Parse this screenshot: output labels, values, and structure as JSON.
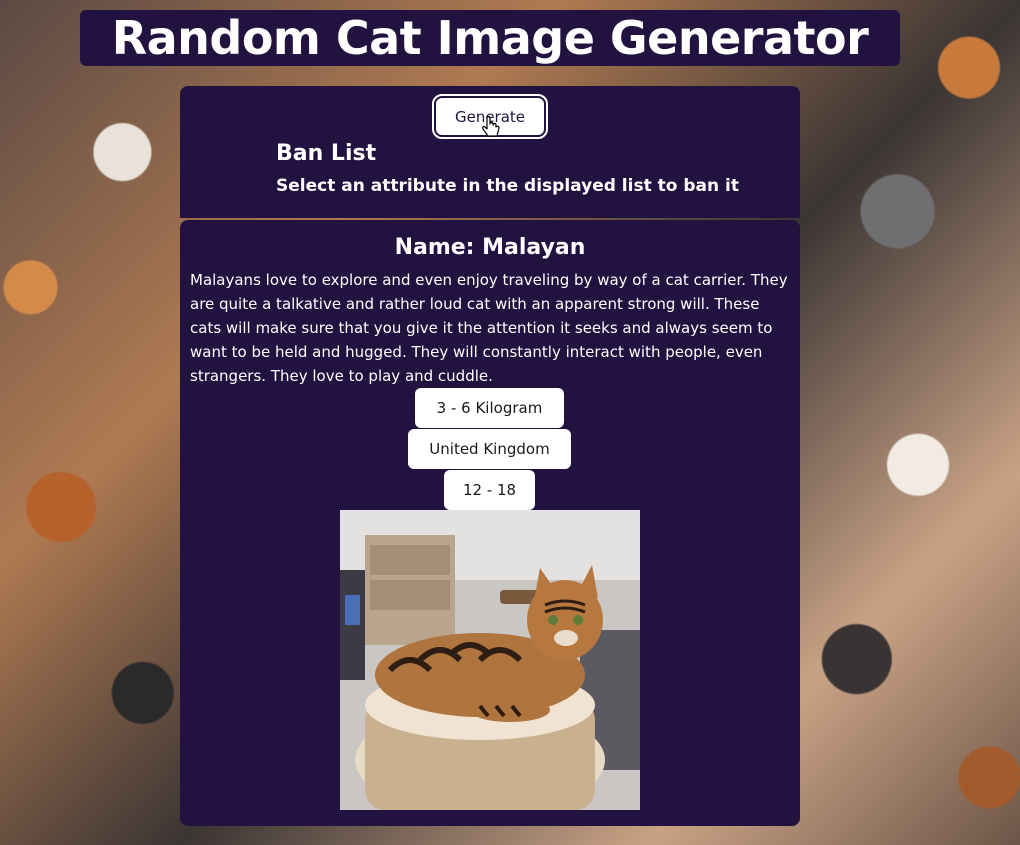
{
  "header": {
    "title": "Random Cat Image Generator"
  },
  "controls": {
    "generate_label": "Generate"
  },
  "ban_list": {
    "title": "Ban List",
    "instruction": "Select an attribute in the displayed list to ban it"
  },
  "cat": {
    "name": "Name: Malayan",
    "description": "Malayans love to explore and even enjoy traveling by way of a cat carrier. They are quite a talkative and rather loud cat with an apparent strong will. These cats will make sure that you give it the attention it seeks and always seem to want to be held and hugged. They will constantly interact with people, even strangers. They love to play and cuddle.",
    "attributes": [
      "3 - 6 Kilogram",
      "United Kingdom",
      "12 - 18"
    ]
  },
  "colors": {
    "panel_bg": "#21123f",
    "button_bg": "#ffffff",
    "text": "#ffffff"
  },
  "icons": {
    "cursor": "hand-pointer-icon",
    "photo": "cat-photo"
  }
}
